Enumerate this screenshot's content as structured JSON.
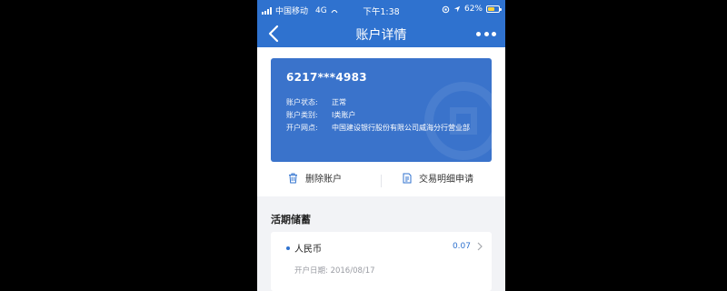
{
  "statusbar": {
    "carrier": "中国移动",
    "network": "4G",
    "time": "下午1:38",
    "battery_percent": "62%",
    "battery_level": 0.62
  },
  "navbar": {
    "title": "账户详情"
  },
  "account_card": {
    "number": "6217***4983",
    "rows": [
      {
        "label": "账户状态:",
        "value": "正常"
      },
      {
        "label": "账户类别:",
        "value": "I类账户"
      },
      {
        "label": "开户网点:",
        "value": "中国建设银行股份有限公司威海分行营业部"
      }
    ]
  },
  "actions": {
    "delete_label": "删除账户",
    "statement_label": "交易明细申请"
  },
  "savings": {
    "section_title": "活期储蓄",
    "item": {
      "currency": "人民币",
      "balance": "0.07",
      "date_label": "开户日期:",
      "date_value": "2016/08/17"
    }
  },
  "colors": {
    "brand_blue": "#2f72cf",
    "card_blue": "#3a73cb"
  }
}
